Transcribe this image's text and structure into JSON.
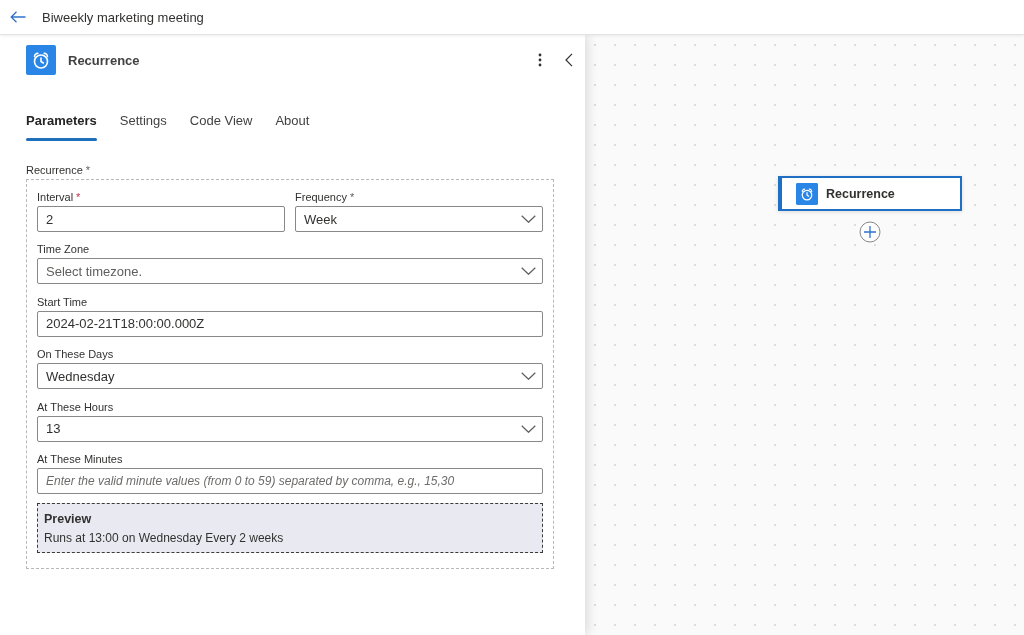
{
  "top_bar": {
    "title": "Biweekly marketing meeting"
  },
  "panel": {
    "title": "Recurrence",
    "tabs": [
      {
        "label": "Parameters",
        "selected": true
      },
      {
        "label": "Settings",
        "selected": false
      },
      {
        "label": "Code View",
        "selected": false
      },
      {
        "label": "About",
        "selected": false
      }
    ],
    "group": {
      "label": "Recurrence",
      "mark": "*",
      "mark_alert": false,
      "rows": [
        [
          {
            "kind": "text",
            "label": "Interval",
            "mark": "*",
            "mark_alert": true,
            "value": "2"
          },
          {
            "kind": "dropdown",
            "label": "Frequency",
            "mark": "*",
            "mark_alert": false,
            "value": "Week"
          }
        ],
        [
          {
            "kind": "dropdown",
            "label": "Time Zone",
            "placeholder": "Select timezone."
          }
        ],
        [
          {
            "kind": "text",
            "label": "Start Time",
            "value": "2024-02-21T18:00:00.000Z"
          }
        ],
        [
          {
            "kind": "dropdown",
            "label": "On These Days",
            "value": "Wednesday"
          }
        ],
        [
          {
            "kind": "dropdown",
            "label": "At These Hours",
            "value": "13"
          }
        ],
        [
          {
            "kind": "text",
            "label": "At These Minutes",
            "placeholder": "Enter the valid minute values (from 0 to 59) separated by comma, e.g., 15,30"
          }
        ]
      ],
      "preview": {
        "title": "Preview",
        "text": "Runs at 13:00 on Wednesday Every 2 weeks"
      }
    }
  },
  "canvas": {
    "nodes": [
      {
        "title": "Recurrence",
        "selected": true
      }
    ]
  }
}
